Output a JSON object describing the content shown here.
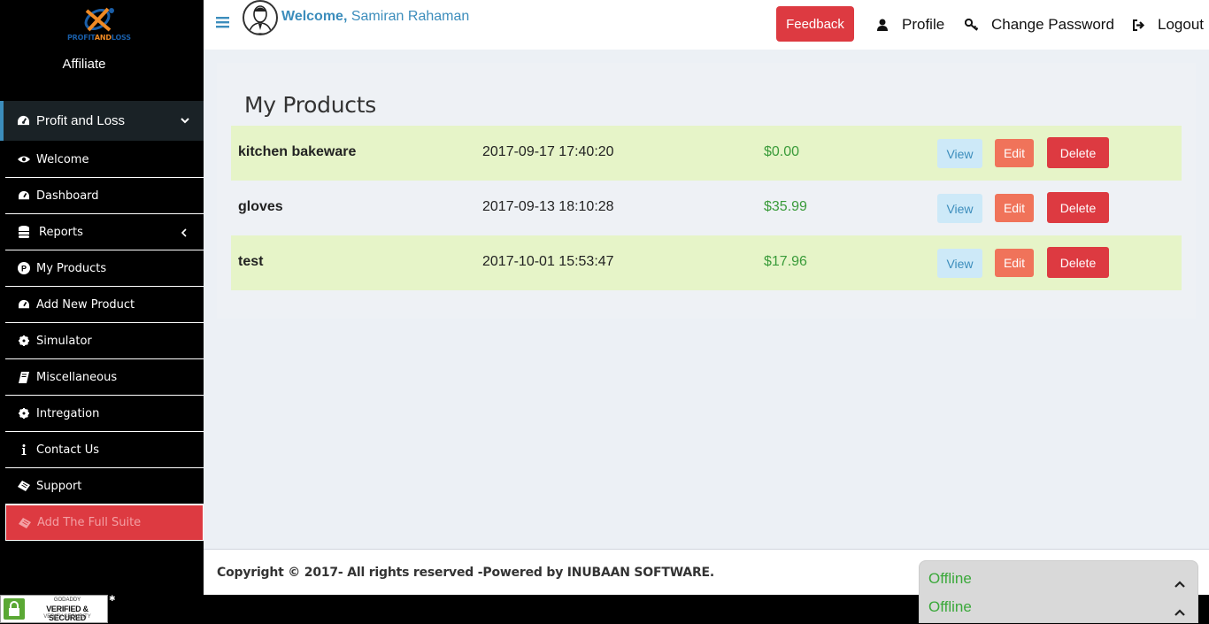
{
  "brand": {
    "logo_prefix": "PROFIT",
    "logo_and": "AND",
    "logo_suffix": "LOSS",
    "role": "Affiliate"
  },
  "sidebar": {
    "section": {
      "label": "Profit and Loss",
      "icon": "dashboard-icon"
    },
    "items": [
      {
        "label": "Welcome",
        "icon": "eye-icon"
      },
      {
        "label": "Dashboard",
        "icon": "dashboard-icon"
      },
      {
        "label": "Reports",
        "icon": "database-icon"
      },
      {
        "label": "My Products",
        "icon": "product-icon"
      },
      {
        "label": "Add New Product",
        "icon": "dashboard-icon"
      },
      {
        "label": "Simulator",
        "icon": "gear-icon"
      },
      {
        "label": "Miscellaneous",
        "icon": "book-icon"
      },
      {
        "label": "Intregation",
        "icon": "gear-icon"
      },
      {
        "label": "Contact Us",
        "icon": "info-icon"
      },
      {
        "label": "Support",
        "icon": "ticket-icon"
      },
      {
        "label": "Add The Full Suite",
        "icon": "ticket-icon"
      }
    ]
  },
  "header": {
    "welcome_label": "Welcome,",
    "user_name": "Samiran Rahaman",
    "feedback_label": "Feedback",
    "profile_label": "Profile",
    "change_password_label": "Change Password",
    "logout_label": "Logout"
  },
  "main": {
    "title": "My Products",
    "actions": {
      "view": "View",
      "edit": "Edit",
      "delete": "Delete"
    },
    "products": [
      {
        "name": "kitchen bakeware",
        "date": "2017-09-17 17:40:20",
        "price": "$0.00"
      },
      {
        "name": "gloves",
        "date": "2017-09-13 18:10:28",
        "price": "$35.99"
      },
      {
        "name": "test",
        "date": "2017-10-01 15:53:47",
        "price": "$17.96"
      }
    ]
  },
  "footer": {
    "copyright": "Copyright © 2017- All rights reserved -Powered by INUBAAN SOFTWARE."
  },
  "chat": {
    "status_1": "Offline",
    "status_2": "Offline"
  },
  "badge": {
    "line1": "GODADDY",
    "line2": "VERIFIED & SECURED",
    "line3": "VERIFY SECURITY"
  },
  "colors": {
    "accent": "#3c8dbc",
    "danger": "#dd3a41",
    "warning": "#f0735a",
    "price": "#3a9b3a",
    "row_highlight": "#e6f4c8"
  }
}
